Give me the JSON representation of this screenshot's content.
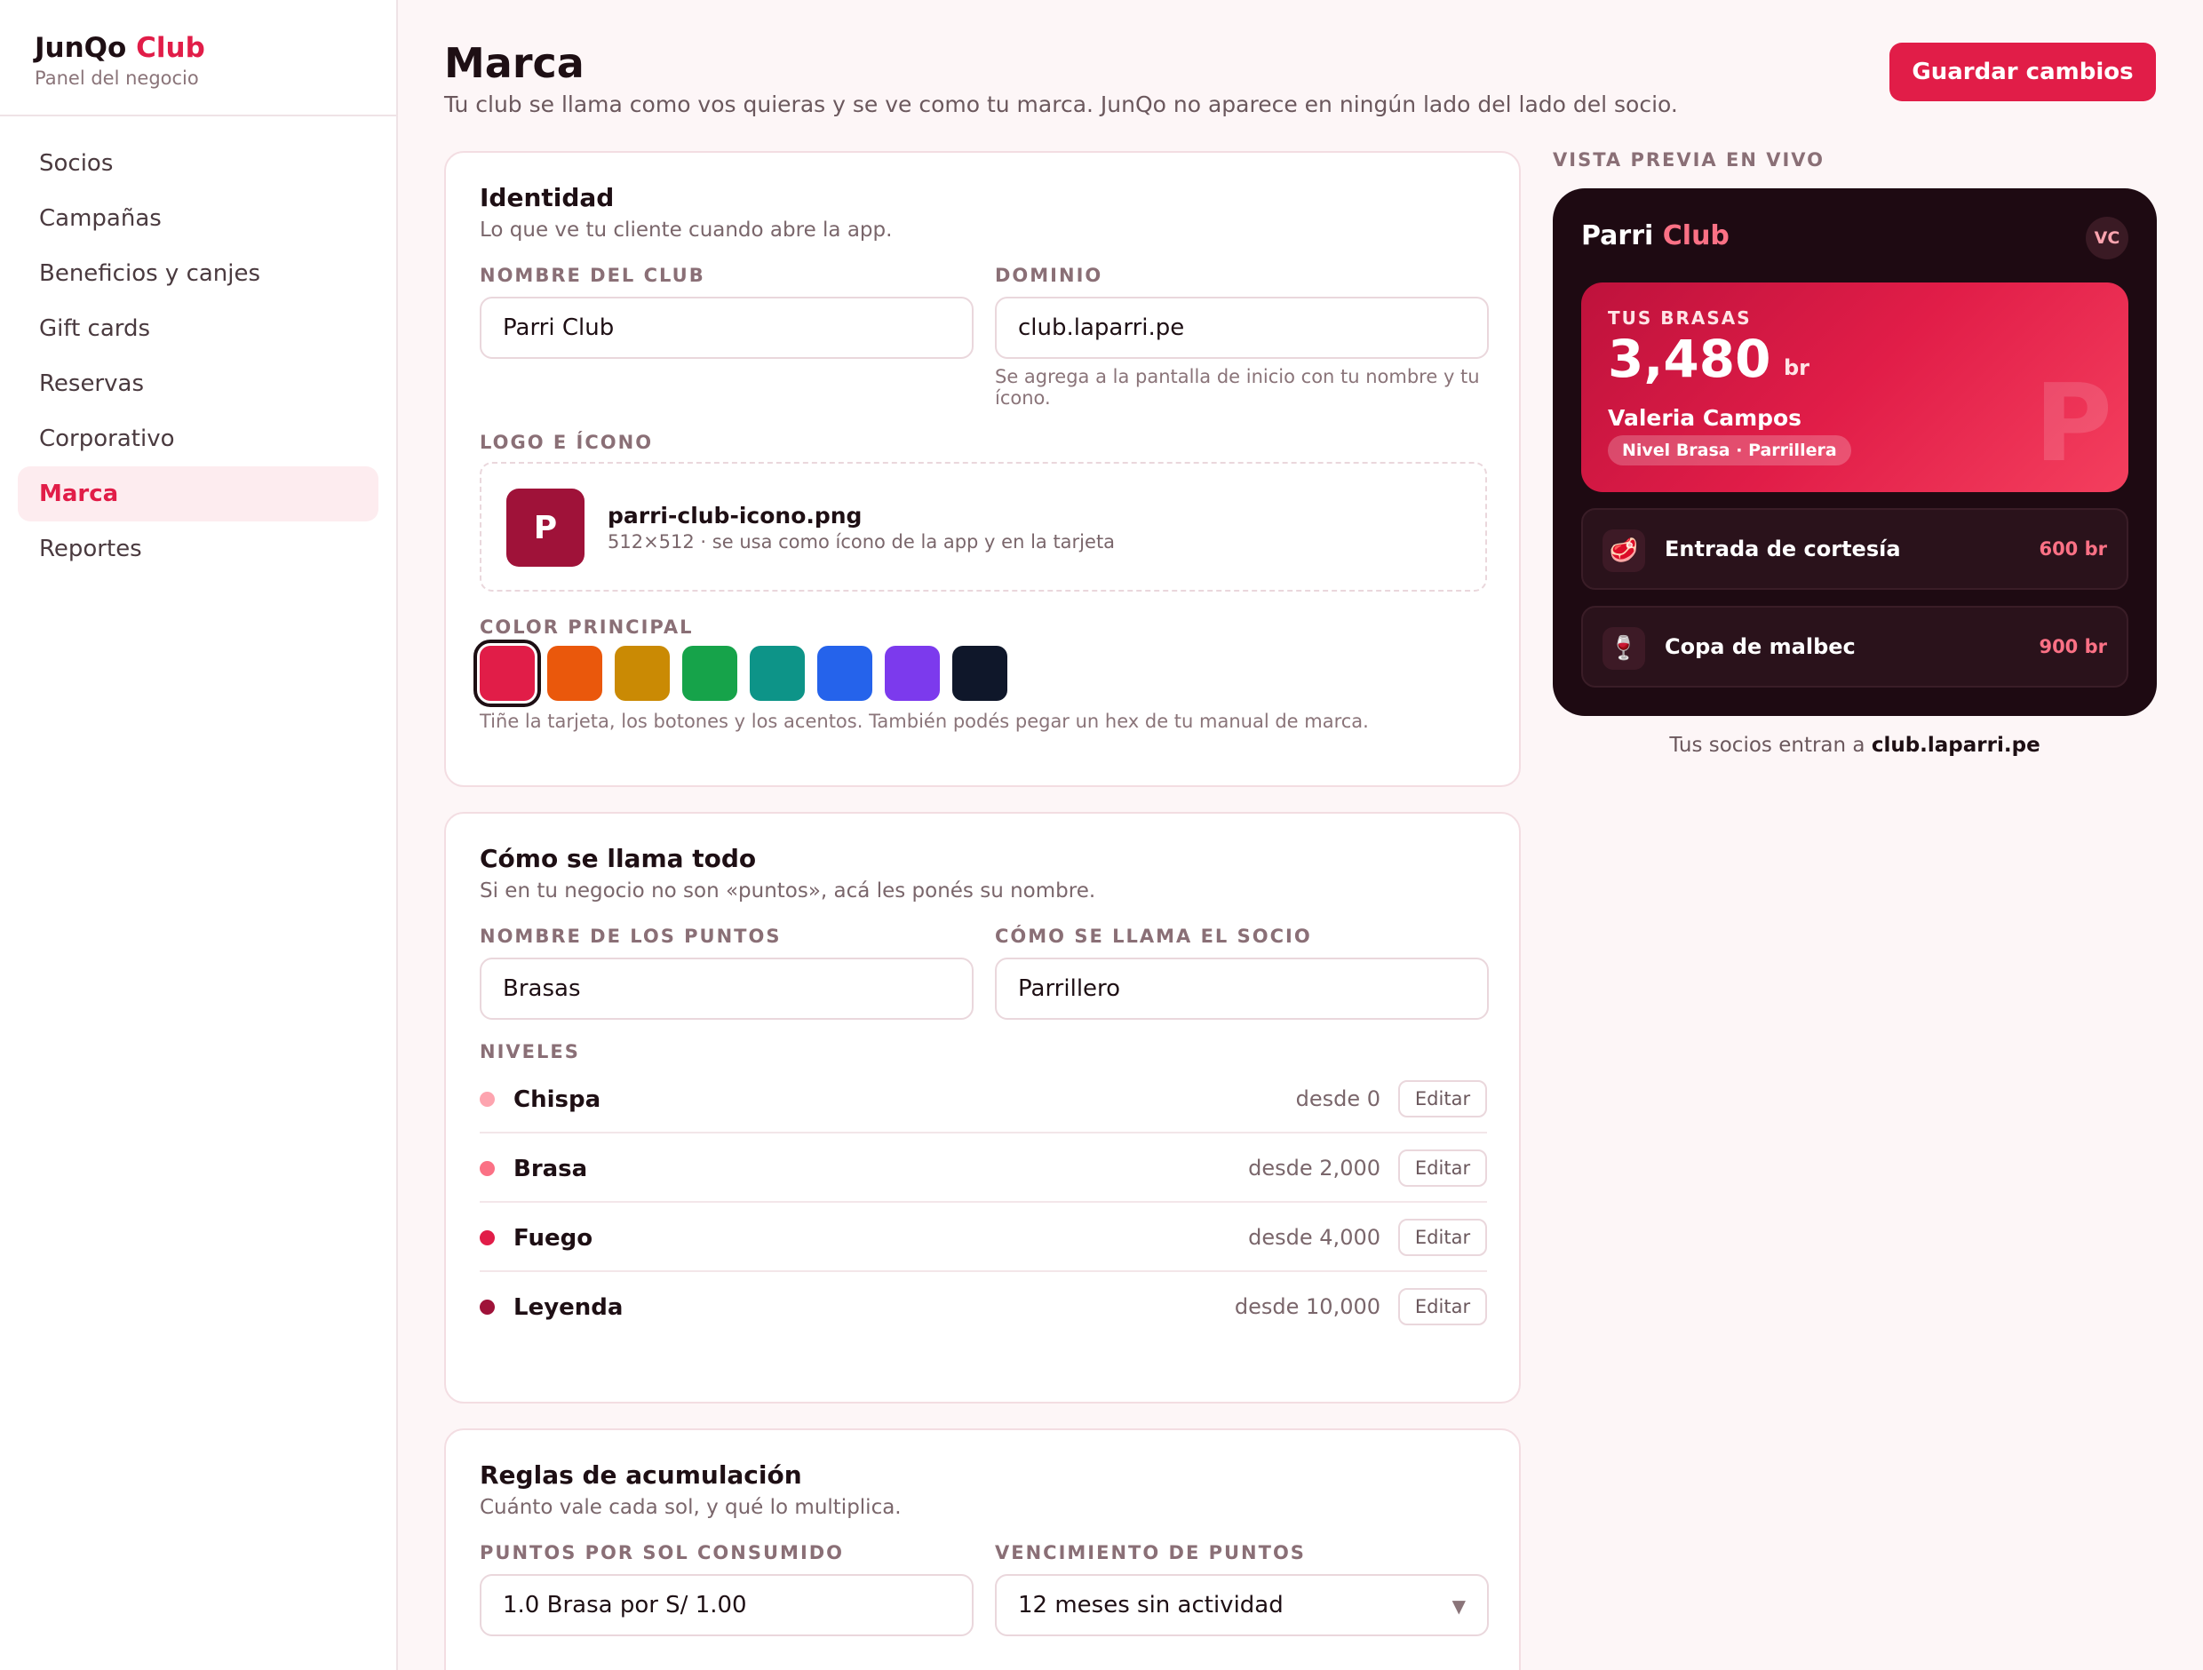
{
  "sidebar": {
    "brand": {
      "name_main": "JunQo",
      "name_accent": "Club",
      "subtitle": "Panel del negocio"
    },
    "items": [
      {
        "label": "Socios",
        "active": false
      },
      {
        "label": "Campañas",
        "active": false
      },
      {
        "label": "Beneficios y canjes",
        "active": false
      },
      {
        "label": "Gift cards",
        "active": false
      },
      {
        "label": "Reservas",
        "active": false
      },
      {
        "label": "Corporativo",
        "active": false
      },
      {
        "label": "Marca",
        "active": true
      },
      {
        "label": "Reportes",
        "active": false
      }
    ]
  },
  "header": {
    "title": "Marca",
    "subtitle": "Tu club se llama como vos quieras y se ve como tu marca. JunQo no aparece en ningún lado del lado del socio.",
    "save_label": "Guardar cambios"
  },
  "identity": {
    "title": "Identidad",
    "subtitle": "Lo que ve tu cliente cuando abre la app.",
    "club_name_label": "NOMBRE DEL CLUB",
    "club_name_value": "Parri Club",
    "domain_label": "DOMINIO",
    "domain_value": "club.laparri.pe",
    "domain_hint": "Se agrega a la pantalla de inicio con tu nombre y tu ícono.",
    "logo_label": "LOGO E ÍCONO",
    "logo_letter": "P",
    "logo_file": "parri-club-icono.png",
    "logo_meta": "512×512 · se usa como ícono de la app y en la tarjeta",
    "color_label": "COLOR PRINCIPAL",
    "colors": [
      "#e11d48",
      "#ea580c",
      "#ca8a04",
      "#16a34a",
      "#0d9488",
      "#2563eb",
      "#7c3aed",
      "#0f172a"
    ],
    "selected_color": "#e11d48",
    "color_hint": "Tiñe la tarjeta, los botones y los acentos. También podés pegar un hex de tu manual de marca."
  },
  "naming": {
    "title": "Cómo se llama todo",
    "subtitle": "Si en tu negocio no son «puntos», acá les ponés su nombre.",
    "points_label": "NOMBRE DE LOS PUNTOS",
    "points_value": "Brasas",
    "member_label": "CÓMO SE LLAMA EL SOCIO",
    "member_value": "Parrillero",
    "levels_label": "NIVELES",
    "edit_label": "Editar",
    "levels": [
      {
        "name": "Chispa",
        "from": "desde 0",
        "color": "#fda4af"
      },
      {
        "name": "Brasa",
        "from": "desde 2,000",
        "color": "#fb7185"
      },
      {
        "name": "Fuego",
        "from": "desde 4,000",
        "color": "#e11d48"
      },
      {
        "name": "Leyenda",
        "from": "desde 10,000",
        "color": "#9f1239"
      }
    ]
  },
  "accrual": {
    "title": "Reglas de acumulación",
    "subtitle": "Cuánto vale cada sol, y qué lo multiplica.",
    "rate_label": "PUNTOS POR SOL CONSUMIDO",
    "rate_value": "1.0 Brasa por S/ 1.00",
    "expiry_label": "VENCIMIENTO DE PUNTOS",
    "expiry_value": "12 meses sin actividad"
  },
  "preview": {
    "label": "VISTA PREVIA EN VIVO",
    "brand_main": "Parri",
    "brand_accent": "Club",
    "avatar": "VC",
    "points_label": "TUS BRASAS",
    "points_value": "3,480",
    "points_unit": "br",
    "member_name": "Valeria Campos",
    "member_badge": "Nivel Brasa · Parrillera",
    "card_mark": "P",
    "rewards": [
      {
        "icon": "steak-icon",
        "glyph": "🥩",
        "name": "Entrada de cortesía",
        "cost": "600 br"
      },
      {
        "icon": "wine-glass-icon",
        "glyph": "🍷",
        "name": "Copa de malbec",
        "cost": "900 br"
      }
    ],
    "footer_prefix": "Tus socios entran a",
    "footer_domain": "club.laparri.pe"
  }
}
